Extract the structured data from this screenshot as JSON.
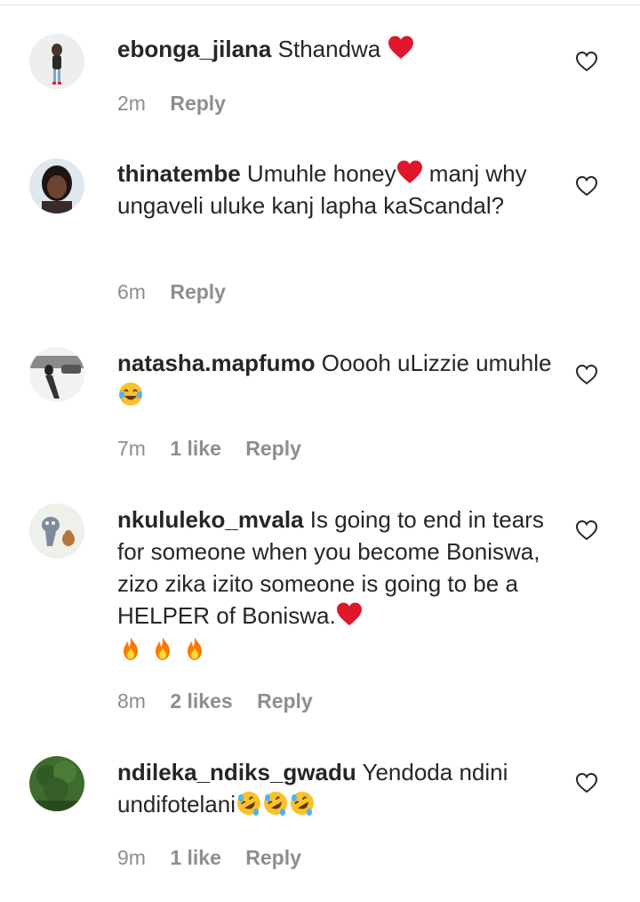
{
  "comments": [
    {
      "username": "ebonga_jilana",
      "text": "Sthandwa",
      "time": "2m",
      "likes": "",
      "reply": "Reply"
    },
    {
      "username": "thinatembe",
      "text": "Umuhle honey",
      "text2": " manj why ungaveli uluke kanj lapha kaScandal?",
      "time": "6m",
      "likes": "",
      "reply": "Reply"
    },
    {
      "username": "natasha.mapfumo",
      "text": "Ooooh uLizzie umuhle",
      "time": "7m",
      "likes": "1 like",
      "reply": "Reply"
    },
    {
      "username": "nkululeko_mvala",
      "text": "Is going to end in tears for someone when you become Boniswa, zizo zika izito someone is going to be a HELPER of Boniswa.",
      "time": "8m",
      "likes": "2 likes",
      "reply": "Reply"
    },
    {
      "username": "ndileka_ndiks_gwadu",
      "text": "Yendoda ndini undifotelani",
      "time": "9m",
      "likes": "1 like",
      "reply": "Reply"
    }
  ],
  "icons": {
    "like": "heart-outline-icon",
    "heart_emoji": "red-heart-emoji",
    "laugh_emoji": "face-with-tears-of-joy-emoji",
    "rofl_emoji": "rolling-on-floor-laughing-emoji",
    "fire_emoji": "fire-emoji"
  },
  "colors": {
    "text": "#262626",
    "meta": "#8e8e8e",
    "heart": "#e0162b"
  }
}
